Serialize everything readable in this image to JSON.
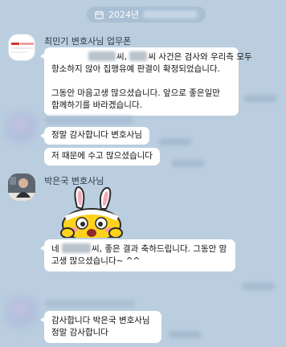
{
  "date_divider": {
    "year": "2024년"
  },
  "messages": [
    {
      "sender": "최민기 변호사님 업무폰",
      "avatar_logo": "법무법인",
      "bubble_lines": {
        "l1_post": "씨,",
        "l1_post2": "씨 사건은 검사와 우리측 모두",
        "l2": "항소하지 않아 집행유예 판결이 확정되었습니다.",
        "l3": "그동안 마음고생 많으셨습니다. 앞으로 좋은일만",
        "l4": "함께하기를 바라겠습니다."
      }
    },
    {
      "sender": "",
      "bubbles": [
        "정말 감사합니다 변호사님",
        "저 때문에 수고 많으셨습니다"
      ]
    },
    {
      "sender": "박은국 변호사님",
      "sticker": "rabbit-hood-character",
      "bubble_lines": {
        "l1_pre": "네",
        "l1_post": "씨, 좋은 결과 축하드립니다. 그동안 맘",
        "l2": "고생 많으셨습니다~ ^^"
      }
    },
    {
      "sender": "",
      "bubble_lines": {
        "l1": "감사합니다 박은국 변호사님",
        "l2": "정말 감사합니다"
      }
    }
  ],
  "colors": {
    "background": "#bacee0",
    "bubble": "#ffffff",
    "date_pill": "#a9bfd4"
  }
}
